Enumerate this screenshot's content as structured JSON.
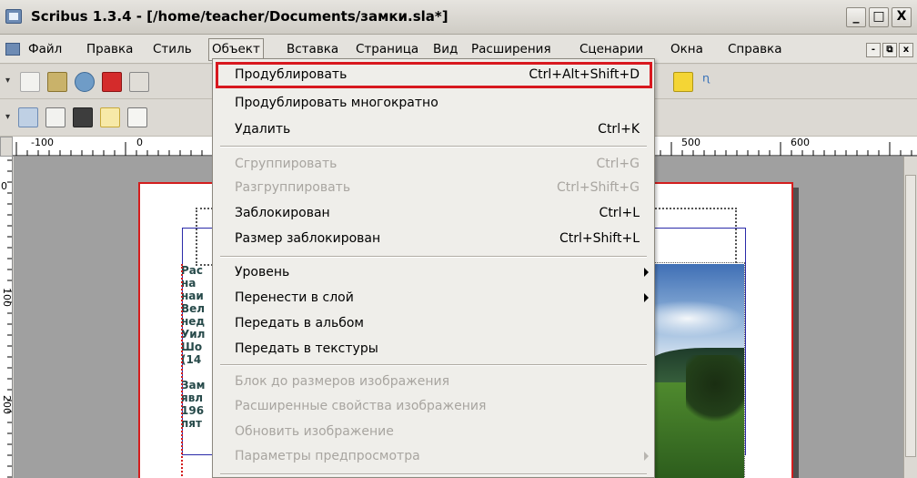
{
  "window": {
    "title": "Scribus 1.3.4 - [/home/teacher/Documents/замки.sla*]",
    "controls": {
      "minimize": "_",
      "maximize": "□",
      "close": "X"
    }
  },
  "menubar": {
    "items": [
      {
        "label": "Файл",
        "active": false
      },
      {
        "label": "Правка",
        "active": false
      },
      {
        "label": "Стиль",
        "active": false
      },
      {
        "label": "Объект",
        "active": true
      },
      {
        "label": "Вставка",
        "active": false
      },
      {
        "label": "Страница",
        "active": false
      },
      {
        "label": "Вид",
        "active": false
      },
      {
        "label": "Расширения",
        "active": false
      },
      {
        "label": "Сценарии",
        "active": false
      },
      {
        "label": "Окна",
        "active": false
      },
      {
        "label": "Справка",
        "active": false
      }
    ],
    "mdi_controls": {
      "minimize": "-",
      "restore": "⧉",
      "close": "x"
    }
  },
  "object_menu": {
    "items": [
      {
        "label": "Продублировать",
        "shortcut": "Ctrl+Alt+Shift+D",
        "disabled": false,
        "submenu": false,
        "highlighted": true
      },
      {
        "label": "Продублировать многократно",
        "shortcut": "",
        "disabled": false,
        "submenu": false
      },
      {
        "label": "Удалить",
        "shortcut": "Ctrl+K",
        "disabled": false,
        "submenu": false
      },
      {
        "separator": true
      },
      {
        "label": "Сгруппировать",
        "shortcut": "Ctrl+G",
        "disabled": true,
        "submenu": false
      },
      {
        "label": "Разгруппировать",
        "shortcut": "Ctrl+Shift+G",
        "disabled": true,
        "submenu": false
      },
      {
        "label": "Заблокирован",
        "shortcut": "Ctrl+L",
        "disabled": false,
        "submenu": false
      },
      {
        "label": "Размер заблокирован",
        "shortcut": "Ctrl+Shift+L",
        "disabled": false,
        "submenu": false
      },
      {
        "separator": true
      },
      {
        "label": "Уровень",
        "shortcut": "",
        "disabled": false,
        "submenu": true
      },
      {
        "label": "Перенести в слой",
        "shortcut": "",
        "disabled": false,
        "submenu": true
      },
      {
        "label": "Передать в альбом",
        "shortcut": "",
        "disabled": false,
        "submenu": false
      },
      {
        "label": "Передать в текстуры",
        "shortcut": "",
        "disabled": false,
        "submenu": false
      },
      {
        "separator": true
      },
      {
        "label": "Блок до размеров изображения",
        "shortcut": "",
        "disabled": true,
        "submenu": false
      },
      {
        "label": "Расширенные свойства изображения",
        "shortcut": "",
        "disabled": true,
        "submenu": false
      },
      {
        "label": "Обновить изображение",
        "shortcut": "",
        "disabled": true,
        "submenu": false
      },
      {
        "label": "Параметры предпросмотра",
        "shortcut": "",
        "disabled": true,
        "submenu": true
      }
    ]
  },
  "rulers": {
    "horizontal_labels": [
      "-100",
      "0",
      "500",
      "600"
    ],
    "vertical_labels": [
      "0",
      "100",
      "200"
    ]
  },
  "document": {
    "text_fragments": [
      "Рас",
      "на",
      "наи",
      "Вел",
      "нед",
      "Уил",
      "Шо",
      "(14",
      "",
      "Зам",
      "явл",
      "196",
      "пят"
    ]
  }
}
